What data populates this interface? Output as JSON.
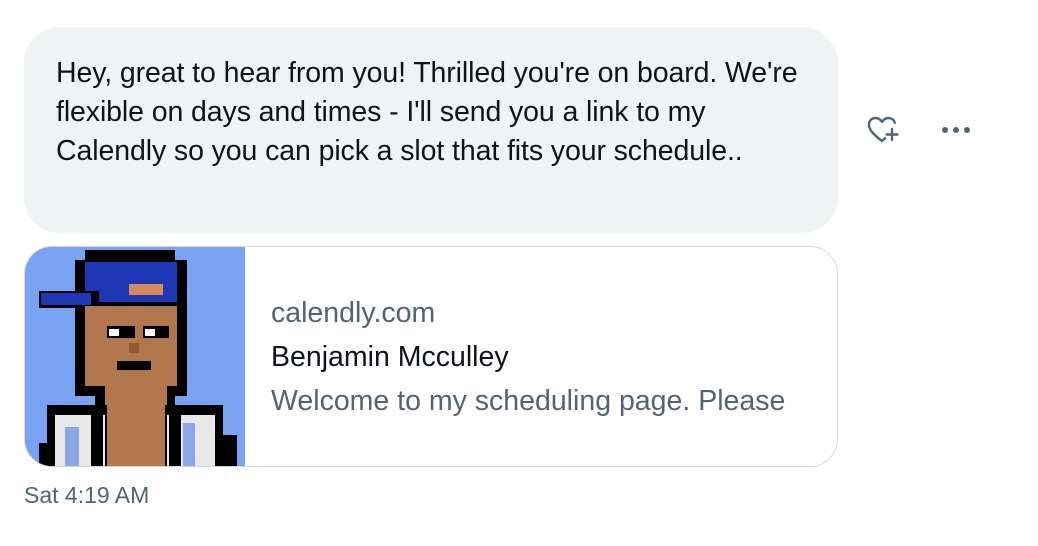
{
  "message": {
    "text": "Hey, great to hear from you! Thrilled you're on board. We're flexible on days and times - I'll send you a link to my Calendly so you can pick a slot that fits your schedule..",
    "timestamp": "Sat 4:19 AM"
  },
  "actions": {
    "react_icon": "heart-plus-icon",
    "more_icon": "more-horizontal-icon"
  },
  "link_card": {
    "domain": "calendly.com",
    "title": "Benjamin Mcculley",
    "description": "Welcome to my scheduling page. Please",
    "image": "pixel-avatar-blue-cap"
  },
  "colors": {
    "bubble_bg": "#eff3f4",
    "text_primary": "#0f1419",
    "text_secondary": "#536471",
    "border": "#cfd9de",
    "avatar_bg": "#7aa2f2"
  }
}
